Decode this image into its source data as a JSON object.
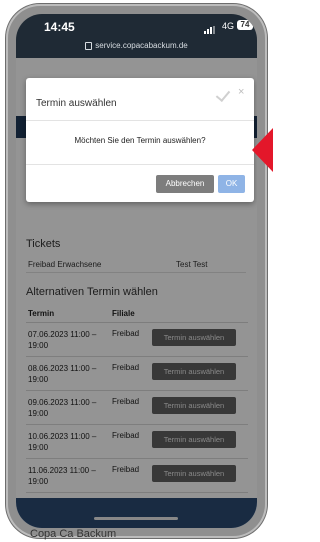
{
  "status_bar": {
    "time": "14:45",
    "network": "4G",
    "battery": "74"
  },
  "browser": {
    "url": "service.copacabackum.de"
  },
  "dialog": {
    "title": "Termin auswählen",
    "message": "Möchten Sie den Termin auswählen?",
    "cancel_label": "Abbrechen",
    "ok_label": "OK"
  },
  "tickets": {
    "title": "Tickets",
    "row": {
      "type": "Freibad Erwachsene",
      "name": "Test Test"
    }
  },
  "alternatives": {
    "title": "Alternativen Termin wählen",
    "headers": {
      "termin": "Termin",
      "filiale": "Filiale"
    },
    "rows": [
      {
        "date": "07.06.2023 11:00 – 19:00",
        "branch": "Freibad",
        "button": "Termin auswählen"
      },
      {
        "date": "08.06.2023 11:00 – 19:00",
        "branch": "Freibad",
        "button": "Termin auswählen"
      },
      {
        "date": "09.06.2023 11:00 – 19:00",
        "branch": "Freibad",
        "button": "Termin auswählen"
      },
      {
        "date": "10.06.2023 11:00 – 19:00",
        "branch": "Freibad",
        "button": "Termin auswählen"
      },
      {
        "date": "11.06.2023 11:00 – 19:00",
        "branch": "Freibad",
        "button": "Termin auswählen"
      }
    ]
  },
  "footer": {
    "brand": "Copa Ca Backum"
  },
  "colors": {
    "header_band": "#1f3a59",
    "ok_button": "#8fb4e6",
    "cancel_button": "#7d7d7d",
    "row_button": "#616161",
    "arrow": "#e3172a"
  }
}
